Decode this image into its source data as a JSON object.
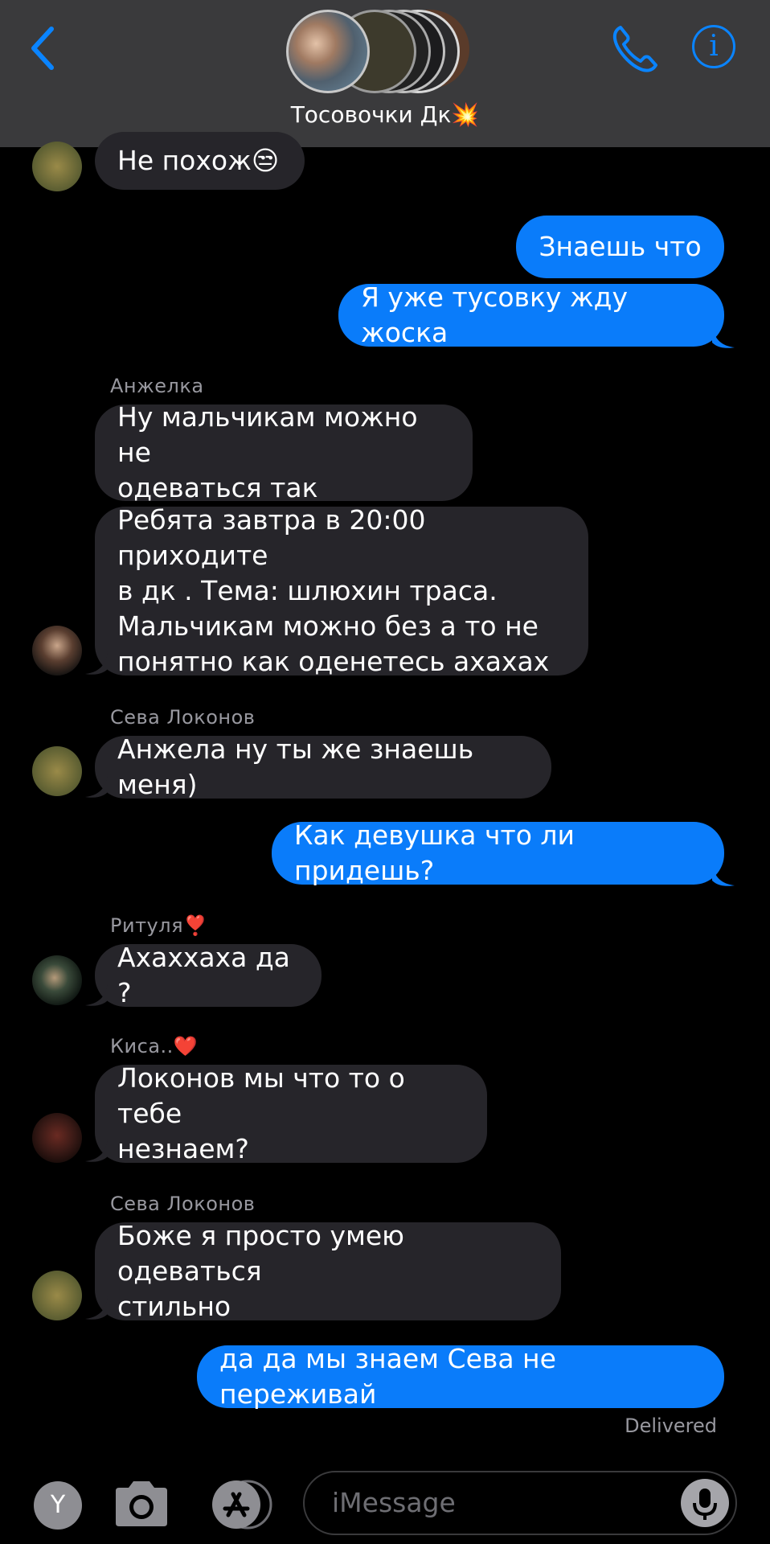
{
  "header": {
    "title": "Тосовочки Дк",
    "title_emoji": "💥",
    "info_label": "i"
  },
  "messages": [
    {
      "id": "m1",
      "dir": "in",
      "text": "Не похож😒"
    },
    {
      "id": "m2",
      "dir": "out",
      "text": "Знаешь что"
    },
    {
      "id": "m3",
      "dir": "out",
      "text": "Я уже тусовку жду жоска"
    },
    {
      "id": "m4",
      "dir": "in",
      "sender": "Анжелка",
      "text": "Ну мальчикам можно не\nодеваться так"
    },
    {
      "id": "m5",
      "dir": "in",
      "text": "Ребята завтра в 20:00 приходите\nв дк . Тема: шлюхин траса.\nМальчикам можно без а то не\nпонятно как оденетесь ахахах"
    },
    {
      "id": "m6",
      "dir": "in",
      "sender": "Сева Локонов",
      "text": "Анжела ну ты же знаешь меня)"
    },
    {
      "id": "m7",
      "dir": "out",
      "text": "Как девушка что ли придешь?"
    },
    {
      "id": "m8",
      "dir": "in",
      "sender": "Ритуля❣️",
      "text": "Ахаххаха да ?"
    },
    {
      "id": "m9",
      "dir": "in",
      "sender": "Киса..❤️",
      "text": "Локонов мы что то о тебе\nнезнаем?"
    },
    {
      "id": "m10",
      "dir": "in",
      "sender": "Сева Локонов",
      "text": "Боже я просто умею одеваться\nстильно"
    },
    {
      "id": "m11",
      "dir": "out",
      "text": "да да мы знаем Сева не переживай"
    }
  ],
  "status": {
    "delivered": "Delivered"
  },
  "composer": {
    "y_label": "Y",
    "placeholder": "iMessage"
  },
  "colors": {
    "outgoing": "#0a7cfa",
    "incoming": "#26252a",
    "accent": "#0a84ff",
    "header": "#3a3a3c"
  },
  "icons": [
    "back-chevron-icon",
    "phone-icon",
    "info-icon",
    "camera-icon",
    "app-store-icon",
    "microphone-icon"
  ]
}
